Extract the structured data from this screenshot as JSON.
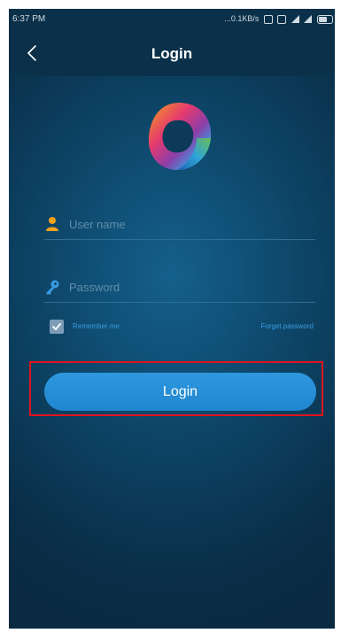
{
  "status_bar": {
    "time": "6:37 PM",
    "network_speed": "...0.1KB/s"
  },
  "header": {
    "title": "Login",
    "back_icon": "chevron-left-icon"
  },
  "logo": {
    "icon": "app-logo",
    "colors": [
      "#f4a21b",
      "#e63a6e",
      "#8c3ea8",
      "#3a9be0",
      "#6cc24a"
    ]
  },
  "form": {
    "username": {
      "placeholder": "User name",
      "value": "",
      "icon": "user-icon"
    },
    "password": {
      "placeholder": "Password",
      "value": "",
      "icon": "key-icon"
    },
    "remember": {
      "label": "Remember me",
      "checked": true
    },
    "forgot_label": "Forget password"
  },
  "login_button": {
    "label": "Login"
  },
  "colors": {
    "accent": "#2e97de",
    "highlight_border": "#e0141e",
    "background_dark": "#0b3049"
  }
}
